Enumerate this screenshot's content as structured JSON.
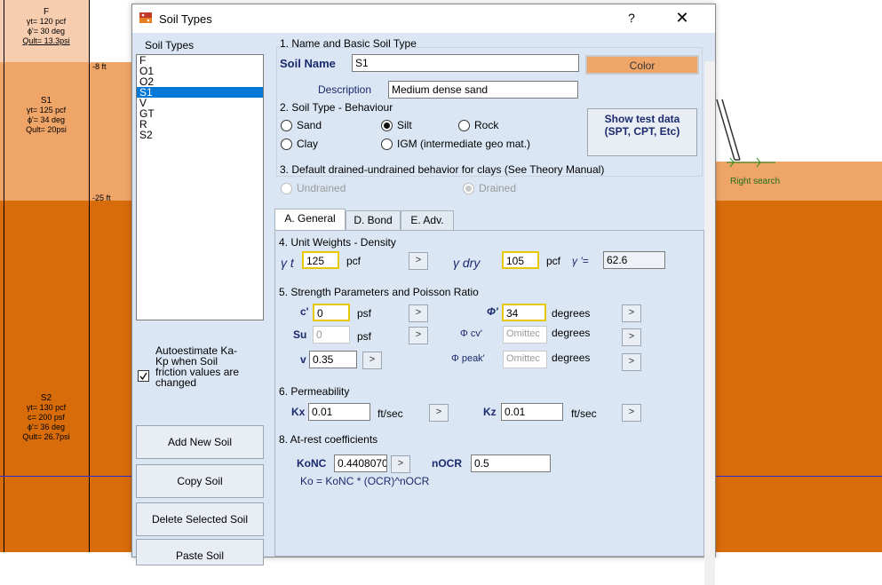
{
  "background": {
    "layers": [
      {
        "name": "F",
        "props": [
          "γt= 120 pcf",
          "ϕ'= 30 deg",
          "Qult= 13.3psi"
        ],
        "color": "#f7cdb0"
      },
      {
        "name": "S1",
        "props": [
          "γt= 125 pcf",
          "ϕ'= 34 deg",
          "Qult= 20psi"
        ],
        "color": "#f0a568"
      },
      {
        "name": "S2",
        "props": [
          "γt= 130 pcf",
          "c= 200 psf",
          "ϕ'= 36 deg",
          "Qult= 26.7psi"
        ],
        "color": "#d86c0a"
      }
    ],
    "depths": [
      "-8 ft",
      "-25 ft"
    ],
    "right_search_label": "Right search"
  },
  "dialog": {
    "title": "Soil Types",
    "help": "?",
    "close": "✕",
    "list_heading": "Soil Types",
    "soil_list": [
      "F",
      "O1",
      "O2",
      "S1",
      "V",
      "GT",
      "R",
      "S2"
    ],
    "selected_soil": "S1",
    "autoestimate_label": "Autoestimate Ka-Kp when Soil friction values are changed",
    "autoestimate_checked": true,
    "buttons": {
      "add": "Add New Soil",
      "copy": "Copy Soil",
      "delete": "Delete Selected Soil",
      "paste": "Paste Soil"
    },
    "section1": {
      "title": "1. Name and Basic Soil Type",
      "soil_name_label": "Soil Name",
      "soil_name_value": "S1",
      "color_button": "Color",
      "color_value": "#f0a568",
      "description_label": "Description",
      "description_value": "Medium dense sand"
    },
    "section2": {
      "title": "2. Soil Type - Behaviour",
      "options": [
        "Sand",
        "Silt",
        "Rock",
        "Clay",
        "IGM (intermediate geo mat.)"
      ],
      "selected": "Silt",
      "show_test_data": "Show test data (SPT, CPT, Etc)"
    },
    "section3": {
      "title": "3. Default drained-undrained behavior for clays (See Theory Manual)",
      "options": [
        "Undrained",
        "Drained"
      ],
      "selected": "Drained"
    },
    "tabs": [
      "A. General",
      "D. Bond",
      "E. Adv."
    ],
    "active_tab": "A. General",
    "unit_weights": {
      "title": "4. Unit Weights - Density",
      "gamma_t_label": "γ t",
      "gamma_t_value": "125",
      "gamma_t_unit": "pcf",
      "gamma_dry_label": "γ dry",
      "gamma_dry_value": "105",
      "gamma_dry_unit": "pcf",
      "gamma_prime_label": "γ '=",
      "gamma_prime_value": "62.6"
    },
    "strength": {
      "title": "5. Strength Parameters and Poisson Ratio",
      "c_label": "c'",
      "c_value": "0",
      "c_unit": "psf",
      "phi_label": "Φ'",
      "phi_value": "34",
      "phi_unit": "degrees",
      "su_label": "Su",
      "su_value": "0",
      "su_unit": "psf",
      "phi_cv_label": "Φ cv'",
      "phi_cv_value": "Omittec",
      "phi_cv_unit": "degrees",
      "v_label": "v",
      "v_value": "0.35",
      "phi_peak_label": "Φ peak'",
      "phi_peak_value": "Omittec",
      "phi_peak_unit": "degrees"
    },
    "permeability": {
      "title": "6. Permeability",
      "kx_label": "Kx",
      "kx_value": "0.01",
      "kx_unit": "ft/sec",
      "kz_label": "Kz",
      "kz_value": "0.01",
      "kz_unit": "ft/sec"
    },
    "atrest": {
      "title": "8. At-rest coefficients",
      "konc_label": "KoNC",
      "konc_value": "0.4408070",
      "nocr_label": "nOCR",
      "nocr_value": "0.5",
      "formula": "Ko = KoNC * (OCR)^nOCR"
    },
    "arrow": ">"
  }
}
